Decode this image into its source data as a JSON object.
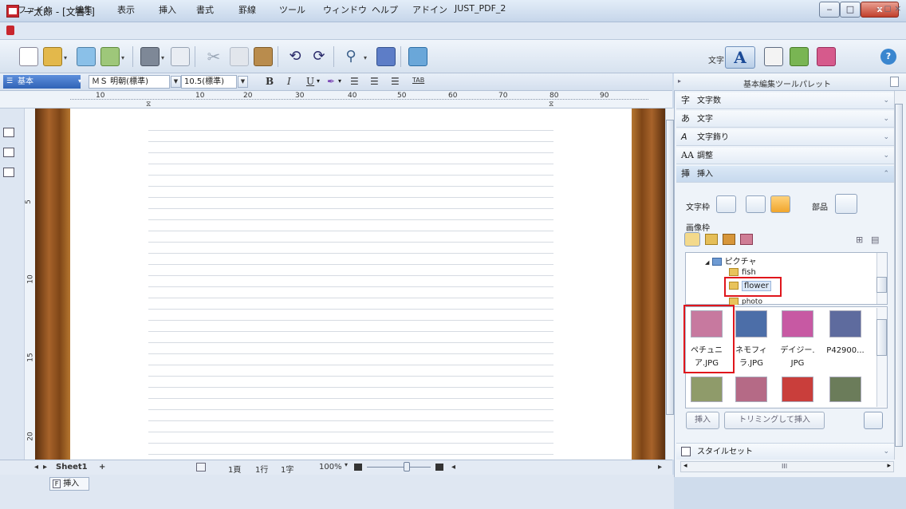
{
  "window": {
    "title": "一太郎 - [文書1]",
    "min": "‒",
    "max": "□",
    "close": "x"
  },
  "menu": {
    "items": [
      "ファイル",
      "編集",
      "表示",
      "挿入",
      "書式",
      "罫線",
      "ツール",
      "ウィンドウ",
      "ヘルプ",
      "アドイン",
      "JUST_PDF_2"
    ],
    "right_controls": "‒ ◻ ×"
  },
  "toolbar": {
    "moji_label": "文字",
    "mode_a": "A"
  },
  "format": {
    "style": "基本",
    "font": "ＭＳ 明朝(標準)",
    "size": "10.5(標準)",
    "bold": "B",
    "italic": "I",
    "underline": "U",
    "tab": "TAB"
  },
  "ruler": {
    "numbers": [
      "10",
      "10",
      "20",
      "30",
      "40",
      "50",
      "60",
      "70",
      "80",
      "90"
    ],
    "vertical": [
      "5",
      "10",
      "15",
      "20"
    ]
  },
  "status": {
    "sheet": "Sheet1",
    "add": "+",
    "page": "1頁",
    "line": "1行",
    "char": "1字",
    "zoom": "100%",
    "mode_tab": "挿入",
    "mode_key": "F"
  },
  "panel": {
    "title": "基本編集ツールパレット",
    "sections": [
      {
        "icon": "字",
        "label": "文字数"
      },
      {
        "icon": "あ",
        "label": "文字"
      },
      {
        "icon": "A",
        "label": "文字飾り"
      },
      {
        "icon": "AA",
        "label": "調整"
      },
      {
        "icon": "挿",
        "label": "挿入"
      }
    ],
    "insert": {
      "text_frame": "文字枠",
      "parts": "部品",
      "image_frame": "画像枠"
    },
    "tree": {
      "root": "ピクチャ",
      "children": [
        "fish",
        "flower",
        "photo"
      ],
      "selected": "flower"
    },
    "thumbnails": [
      {
        "caption_1": "ペチュニ",
        "caption_2": "ア.JPG",
        "color": "#c7799f"
      },
      {
        "caption_1": "ネモフィ",
        "caption_2": "ラ.JPG",
        "color": "#4c6ea8"
      },
      {
        "caption_1": "デイジー.",
        "caption_2": "JPG",
        "color": "#c759a3"
      },
      {
        "caption_1": "P42900...",
        "caption_2": "",
        "color": "#5e6b9e"
      }
    ],
    "thumbnails_row2_colors": [
      "#8f9b6a",
      "#b56a86",
      "#c93e3b",
      "#6b7c5a"
    ],
    "buttons": {
      "insert": "挿入",
      "trim_insert": "トリミングして挿入"
    },
    "style_set": "スタイルセット",
    "hscroll_mark": "III"
  },
  "colors": {
    "accent": "#3063b6",
    "highlight": "#e0161c",
    "wood": "#a7632a"
  }
}
